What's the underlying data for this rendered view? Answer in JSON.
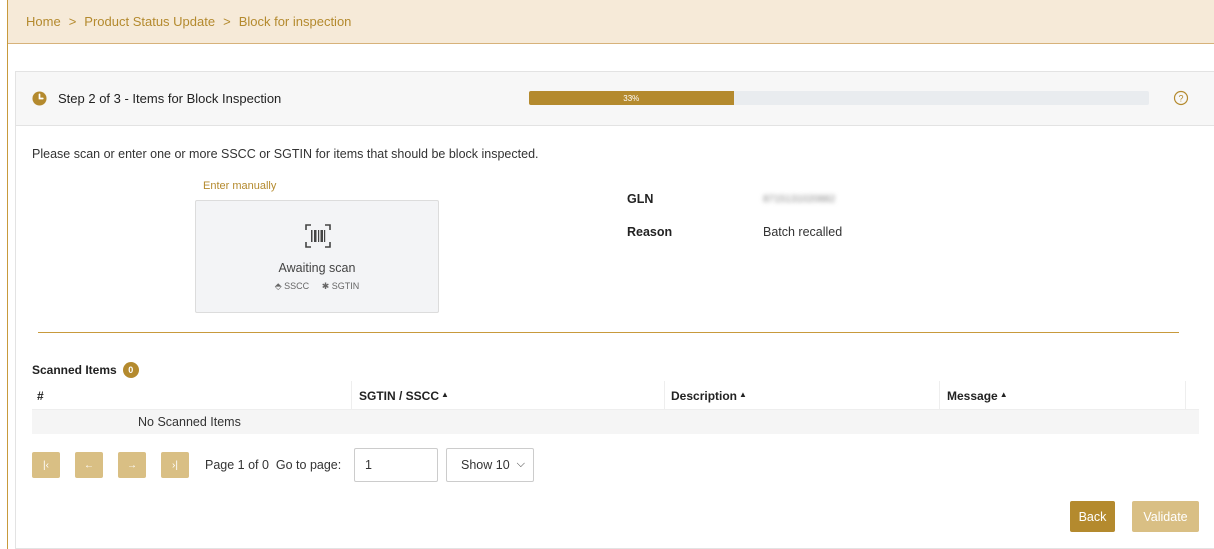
{
  "breadcrumb": {
    "items": [
      "Home",
      "Product Status Update",
      "Block for inspection"
    ],
    "separator": ">"
  },
  "step": {
    "title": "Step 2 of 3 - Items for Block Inspection",
    "progress_label": "33%",
    "progress_value": 0.33,
    "icon": "clock-icon",
    "help_icon": "question-circle-icon"
  },
  "instructions": "Please scan or enter one or more SSCC or SGTIN for items that should be block inspected.",
  "scanner": {
    "enter_manually": "Enter manually",
    "status": "Awaiting scan",
    "types": [
      "SSCC",
      "SGTIN"
    ],
    "icon": "barcode-scan-icon"
  },
  "info": {
    "gln_label": "GLN",
    "gln_value": "8715131020882",
    "reason_label": "Reason",
    "reason_value": "Batch recalled"
  },
  "scanned_items": {
    "title": "Scanned Items",
    "count": "0",
    "columns": [
      "#",
      "SGTIN / SSCC",
      "Description",
      "Message"
    ],
    "empty_text": "No Scanned Items"
  },
  "pagination": {
    "page_info": "Page 1 of 0",
    "goto_label": "Go to page:",
    "goto_value": "1",
    "page_size": "Show 10"
  },
  "actions": {
    "back": "Back",
    "validate": "Validate"
  },
  "colors": {
    "accent": "#b48a2e",
    "accent_light": "#d9bf84",
    "breadcrumb_bg": "#f6ead8"
  }
}
